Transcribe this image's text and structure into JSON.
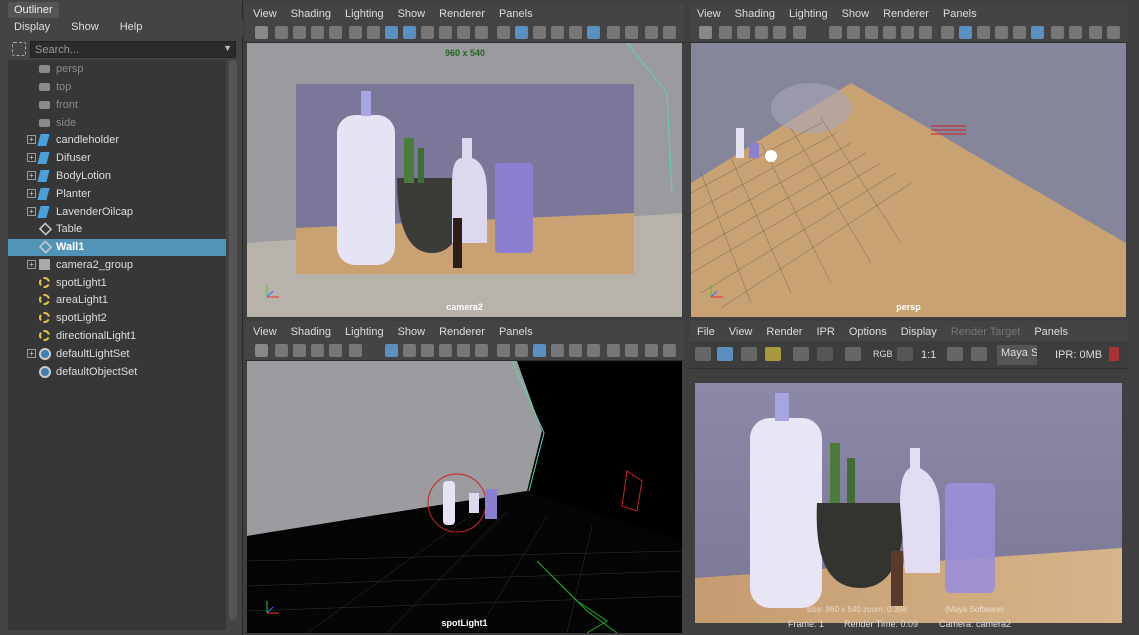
{
  "outliner": {
    "tab": "Outliner",
    "menu": [
      "Display",
      "Show",
      "Help"
    ],
    "search_placeholder": "Search...",
    "items": [
      {
        "label": "persp",
        "icon": "camera-icon"
      },
      {
        "label": "top",
        "icon": "camera-icon"
      },
      {
        "label": "front",
        "icon": "camera-icon"
      },
      {
        "label": "side",
        "icon": "camera-icon"
      },
      {
        "label": "candleholder",
        "icon": "mesh-icon"
      },
      {
        "label": "Difuser",
        "icon": "mesh-icon"
      },
      {
        "label": "BodyLotion",
        "icon": "mesh-icon"
      },
      {
        "label": "Planter",
        "icon": "mesh-icon"
      },
      {
        "label": "LavenderOilcap",
        "icon": "mesh-icon"
      },
      {
        "label": "Table",
        "icon": "mesh-icon"
      },
      {
        "label": "Wall1",
        "icon": "mesh-icon"
      },
      {
        "label": "camera2_group",
        "icon": "group-icon"
      },
      {
        "label": "spotLight1",
        "icon": "spotlight-icon"
      },
      {
        "label": "areaLight1",
        "icon": "arealight-icon"
      },
      {
        "label": "spotLight2",
        "icon": "spotlight-icon"
      },
      {
        "label": "directionalLight1",
        "icon": "directionallight-icon"
      },
      {
        "label": "defaultLightSet",
        "icon": "set-icon"
      },
      {
        "label": "defaultObjectSet",
        "icon": "set-icon"
      }
    ]
  },
  "viewport_menu": [
    "View",
    "Shading",
    "Lighting",
    "Show",
    "Renderer",
    "Panels"
  ],
  "viewports": {
    "top_left": {
      "camera": "camera2",
      "resolution": "960 x 540"
    },
    "top_right": {
      "camera": "persp"
    },
    "bottom_left": {
      "camera": "spotLight1"
    }
  },
  "render_view": {
    "menu": [
      "File",
      "View",
      "Render",
      "IPR",
      "Options",
      "Display",
      "Render Target",
      "Panels"
    ],
    "rgb_label": "RGB",
    "ratio_label": "1:1",
    "renderer": "Maya So",
    "ipr_memory": "IPR: 0MB",
    "overlay_text": "size: 960 x 540 zoom: 0.398",
    "overlay_renderer": "(Maya Software)",
    "frame": "Frame: 1",
    "render_time": "Render Time: 0:09",
    "camera": "Camera: camera2"
  },
  "colors": {
    "selection": "#5294b8",
    "wall": "#7d7a99",
    "table": "#c9a274",
    "lavender": "#8b7fd1",
    "frustum": "#5ad6b0"
  }
}
